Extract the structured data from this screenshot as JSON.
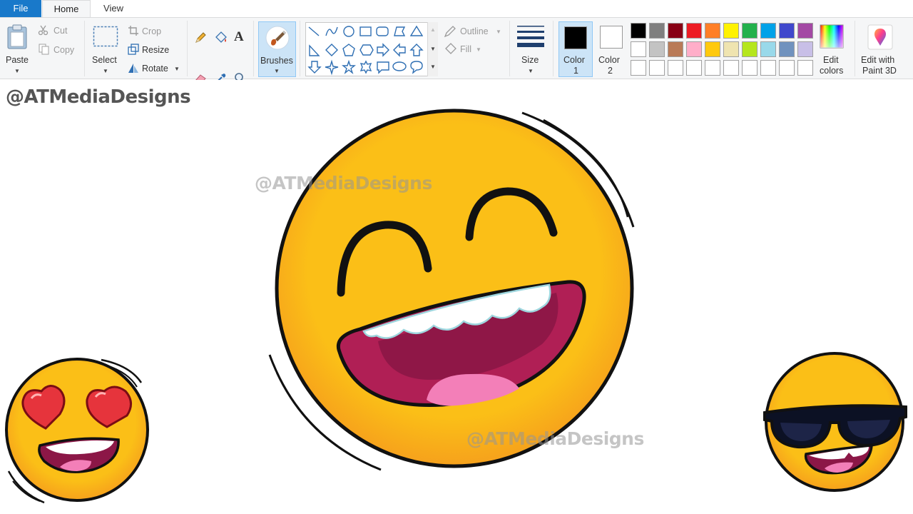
{
  "tabs": {
    "file": "File",
    "home": "Home",
    "view": "View"
  },
  "clipboard": {
    "paste": "Paste",
    "cut": "Cut",
    "copy": "Copy"
  },
  "image": {
    "select": "Select",
    "crop": "Crop",
    "resize": "Resize",
    "rotate": "Rotate"
  },
  "tools": {
    "brushes": "Brushes"
  },
  "shapes": {
    "outline": "Outline",
    "fill": "Fill"
  },
  "size": {
    "label": "Size"
  },
  "colors": {
    "color1_label": "Color",
    "color1_num": "1",
    "color2_label": "Color",
    "color2_num": "2",
    "color1": "#000000",
    "color2": "#ffffff",
    "edit_colors_line1": "Edit",
    "edit_colors_line2": "colors",
    "paint3d_line1": "Edit with",
    "paint3d_line2": "Paint 3D",
    "palette_row1": [
      "#000000",
      "#7f7f7f",
      "#880015",
      "#ed1c24",
      "#ff7f27",
      "#fff200",
      "#22b14c",
      "#00a2e8",
      "#3f48cc",
      "#a349a4"
    ],
    "palette_row2": [
      "#ffffff",
      "#c3c3c3",
      "#b97a57",
      "#ffaec9",
      "#ffc90e",
      "#efe4b0",
      "#b5e61d",
      "#99d9ea",
      "#7092be",
      "#c8bfe7"
    ],
    "palette_row3": [
      "#ffffff",
      "#ffffff",
      "#ffffff",
      "#ffffff",
      "#ffffff",
      "#ffffff",
      "#ffffff",
      "#ffffff",
      "#ffffff",
      "#ffffff"
    ]
  },
  "canvas": {
    "watermark_top": "@ATMediaDesigns",
    "watermark_mid": "@ATMediaDesigns",
    "watermark_bottom": "@ATMediaDesigns",
    "face_color": "#fbbf17",
    "face_rim": "#f6a11c"
  }
}
